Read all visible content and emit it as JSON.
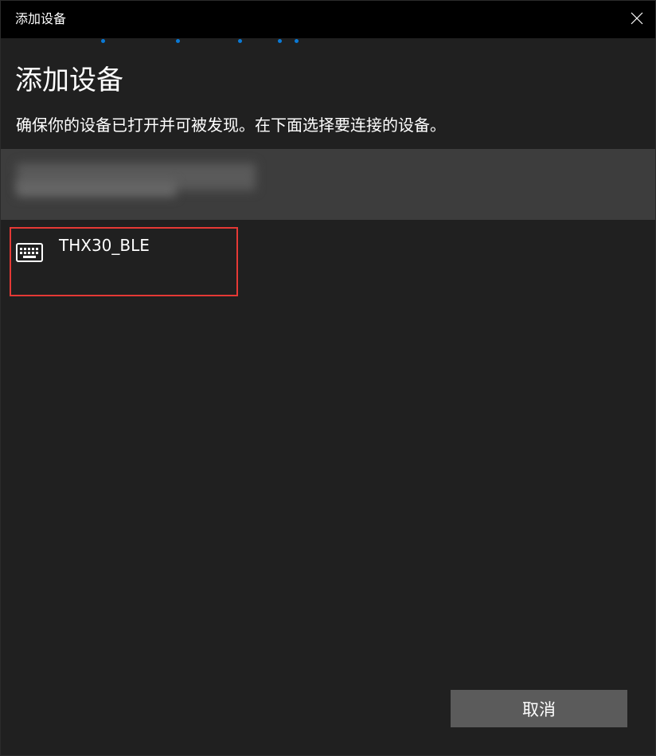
{
  "window": {
    "title": "添加设备"
  },
  "header": {
    "heading": "添加设备",
    "subtitle": "确保你的设备已打开并可被发现。在下面选择要连接的设备。"
  },
  "devices": [
    {
      "name": "",
      "redacted": true,
      "selected": true
    },
    {
      "name": "THX30_BLE",
      "icon": "keyboard-icon",
      "highlighted": true
    }
  ],
  "footer": {
    "cancel_label": "取消"
  },
  "colors": {
    "titlebar": "#000000",
    "background": "#202020",
    "selected_row": "#3d3d3d",
    "accent_dots": "#0a7ad6",
    "highlight_border": "#e53935",
    "button": "#5b5b5b"
  }
}
